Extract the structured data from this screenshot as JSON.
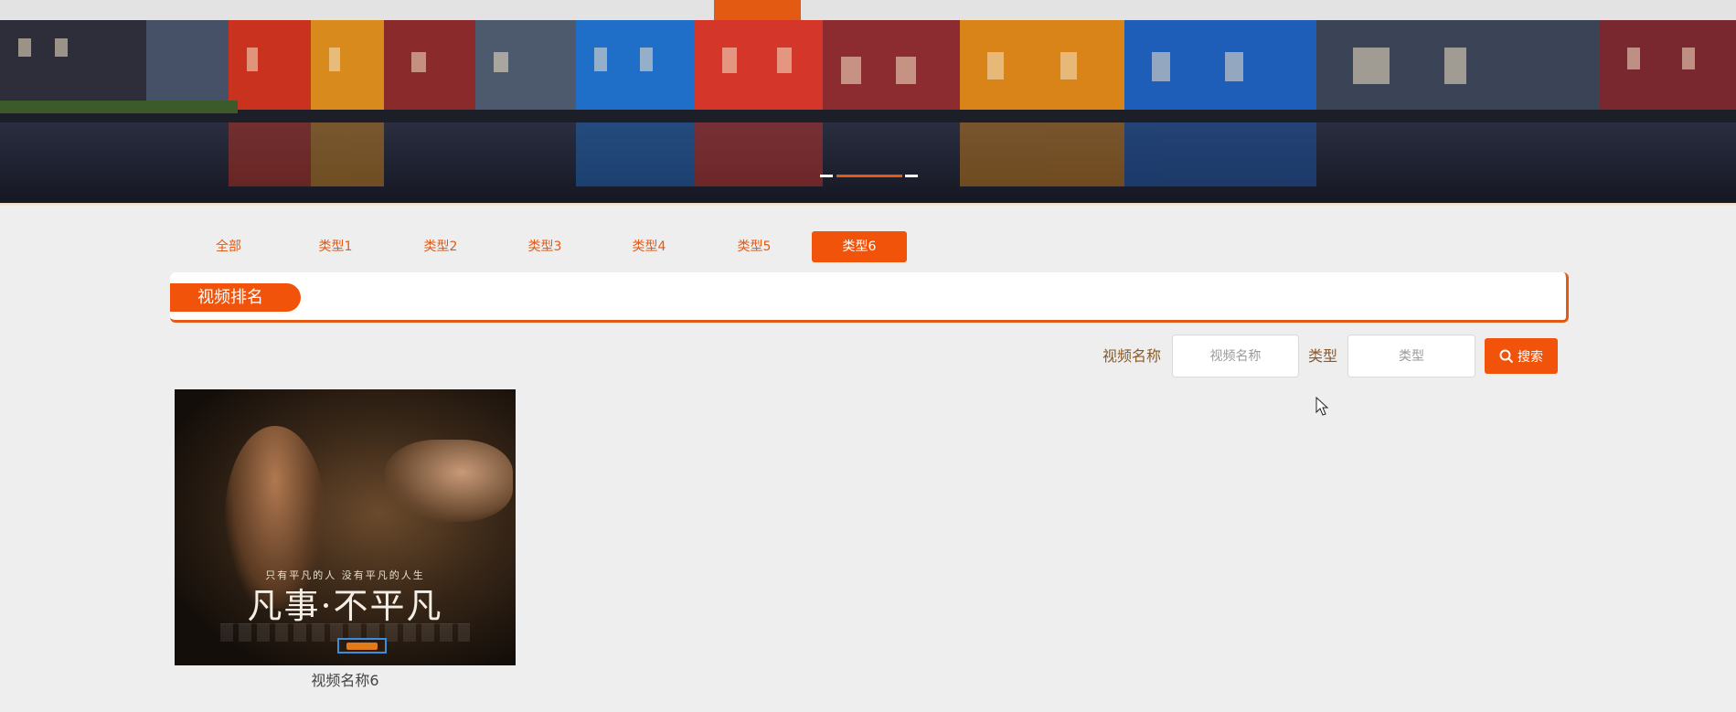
{
  "tabs": {
    "items": [
      "全部",
      "类型1",
      "类型2",
      "类型3",
      "类型4",
      "类型5",
      "类型6"
    ],
    "active_index": 6
  },
  "ranking": {
    "title": "视频排名"
  },
  "search": {
    "name_label": "视频名称",
    "name_placeholder": "视频名称",
    "type_label": "类型",
    "type_placeholder": "类型",
    "button_label": "搜索"
  },
  "videos": [
    {
      "name": "视频名称6",
      "poster_title": "凡事·不平凡",
      "poster_tagline": "只有平凡的人 没有平凡的人生"
    }
  ],
  "colors": {
    "accent": "#f2530a",
    "label": "#8a5a2b"
  },
  "icons": {
    "search_button_icon": "search-icon"
  }
}
